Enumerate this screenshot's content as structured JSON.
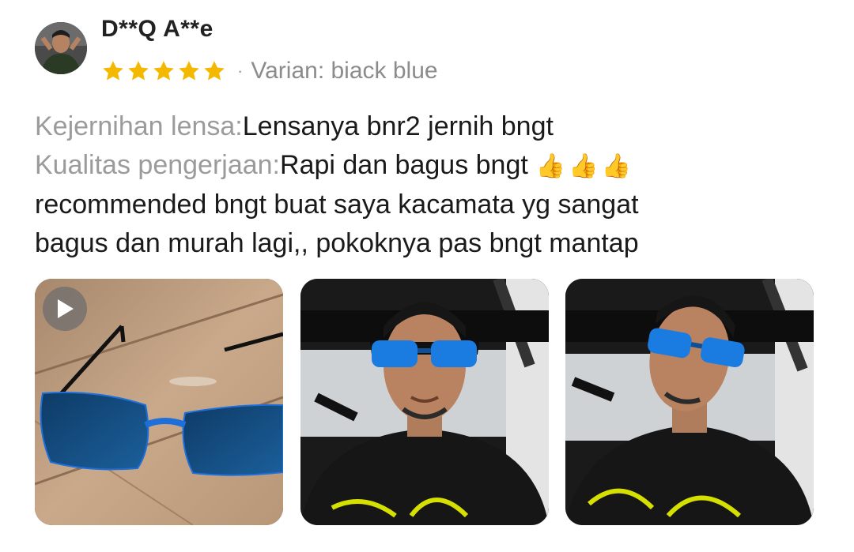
{
  "reviewer": {
    "name": "D**Q A**e",
    "rating": 5,
    "separator": "·",
    "variant": "Varian: biack blue"
  },
  "review": {
    "lens_label": "Kejernihan lensa:",
    "lens_value": "Lensanya bnr2 jernih bngt",
    "quality_label": "Kualitas pengerjaan:",
    "quality_value": "Rapi dan bagus bngt",
    "thumbs": "👍👍👍",
    "body_line1": "recommended bngt buat saya kacamata yg sangat",
    "body_line2": "bagus dan murah lagi,, pokoknya pas bngt mantap"
  },
  "media": [
    {
      "type": "video",
      "icon": "play-icon"
    },
    {
      "type": "image"
    },
    {
      "type": "image"
    }
  ],
  "colors": {
    "star": "#F5B800",
    "label_gray": "#9b9b9b",
    "lens_blue": "#1e6fd9"
  }
}
